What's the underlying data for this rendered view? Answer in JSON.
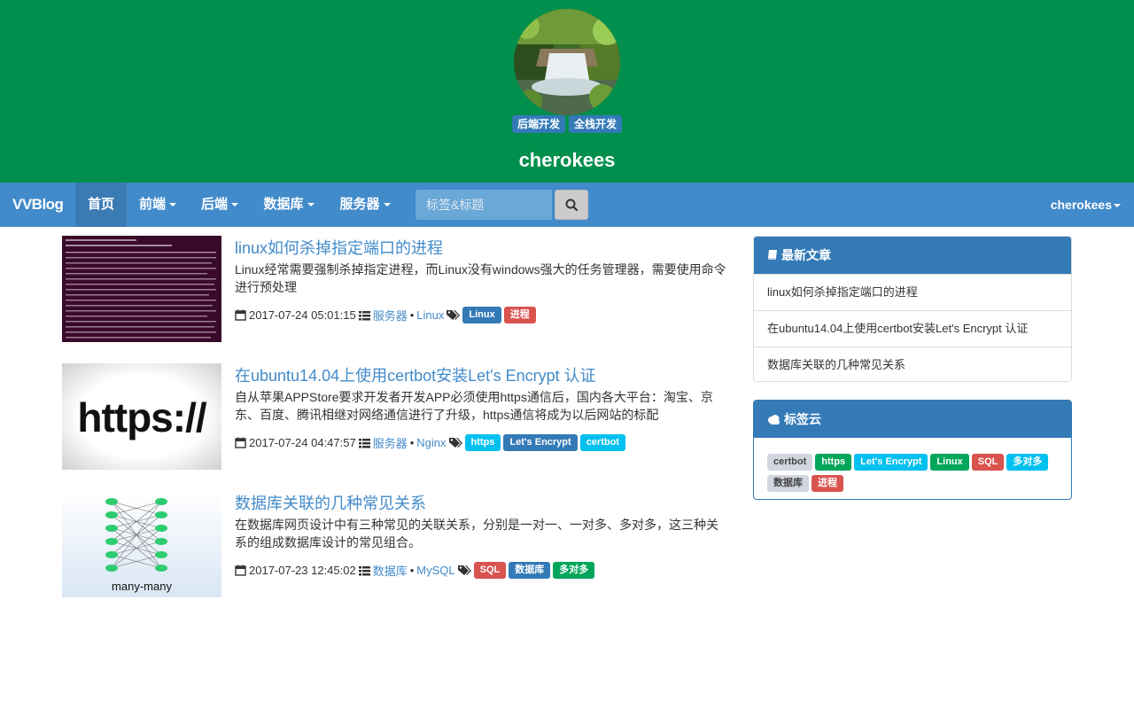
{
  "header": {
    "site_name": "cherokees",
    "tags": [
      "后端开发",
      "全栈开发"
    ]
  },
  "navbar": {
    "brand": "VVBlog",
    "items": [
      {
        "label": "首页",
        "active": true
      },
      {
        "label": "前端",
        "dropdown": true
      },
      {
        "label": "后端",
        "dropdown": true
      },
      {
        "label": "数据库",
        "dropdown": true
      },
      {
        "label": "服务器",
        "dropdown": true
      }
    ],
    "search_placeholder": "标签&标题",
    "user": "cherokees"
  },
  "articles": [
    {
      "title": "linux如何杀掉指定端口的进程",
      "excerpt": "Linux经常需要强制杀掉指定进程，而Linux没有windows强大的任务管理器，需要使用命令进行预处理",
      "date": "2017-07-24 05:01:15",
      "category": "服务器",
      "subcategory": "Linux",
      "tags": [
        {
          "label": "Linux",
          "color": "#337ab7"
        },
        {
          "label": "进程",
          "color": "#d9534f"
        }
      ]
    },
    {
      "title": "在ubuntu14.04上使用certbot安装Let's Encrypt 认证",
      "excerpt": "自从苹果APPStore要求开发者开发APP必须使用https通信后，国内各大平台：淘宝、京东、百度、腾讯相继对网络通信进行了升级，https通信将成为以后网站的标配",
      "date": "2017-07-24 04:47:57",
      "category": "服务器",
      "subcategory": "Nginx",
      "tags": [
        {
          "label": "https",
          "color": "#00c0ef"
        },
        {
          "label": "Let's Encrypt",
          "color": "#337ab7"
        },
        {
          "label": "certbot",
          "color": "#00c0ef"
        }
      ],
      "thumb_text": "https://"
    },
    {
      "title": "数据库关联的几种常见关系",
      "excerpt": "在数据库网页设计中有三种常见的关联关系，分别是一对一、一对多、多对多，这三种关系的组成数据库设计的常见组合。",
      "date": "2017-07-23 12:45:02",
      "category": "数据库",
      "subcategory": "MySQL",
      "tags": [
        {
          "label": "SQL",
          "color": "#d9534f"
        },
        {
          "label": "数据库",
          "color": "#337ab7"
        },
        {
          "label": "多对多",
          "color": "#00a65a"
        }
      ],
      "thumb_text": "many-many"
    }
  ],
  "sidebar": {
    "latest_title": "最新文章",
    "latest": [
      "linux如何杀掉指定端口的进程",
      "在ubuntu14.04上使用certbot安装Let's Encrypt 认证",
      "数据库关联的几种常见关系"
    ],
    "tagcloud_title": "标签云",
    "tagcloud": [
      {
        "label": "certbot",
        "color": "#d2d6de"
      },
      {
        "label": "https",
        "color": "#00a65a"
      },
      {
        "label": "Let's Encrypt",
        "color": "#00c0ef"
      },
      {
        "label": "Linux",
        "color": "#00a65a"
      },
      {
        "label": "SQL",
        "color": "#d9534f"
      },
      {
        "label": "多对多",
        "color": "#00c0ef"
      },
      {
        "label": "数据库",
        "color": "#d2d6de"
      },
      {
        "label": "进程",
        "color": "#d9534f"
      }
    ]
  },
  "colors": {
    "header_bg": "#008f4c",
    "navbar_bg": "#428bca",
    "link": "#428bca",
    "panel_head": "#337ab7"
  }
}
